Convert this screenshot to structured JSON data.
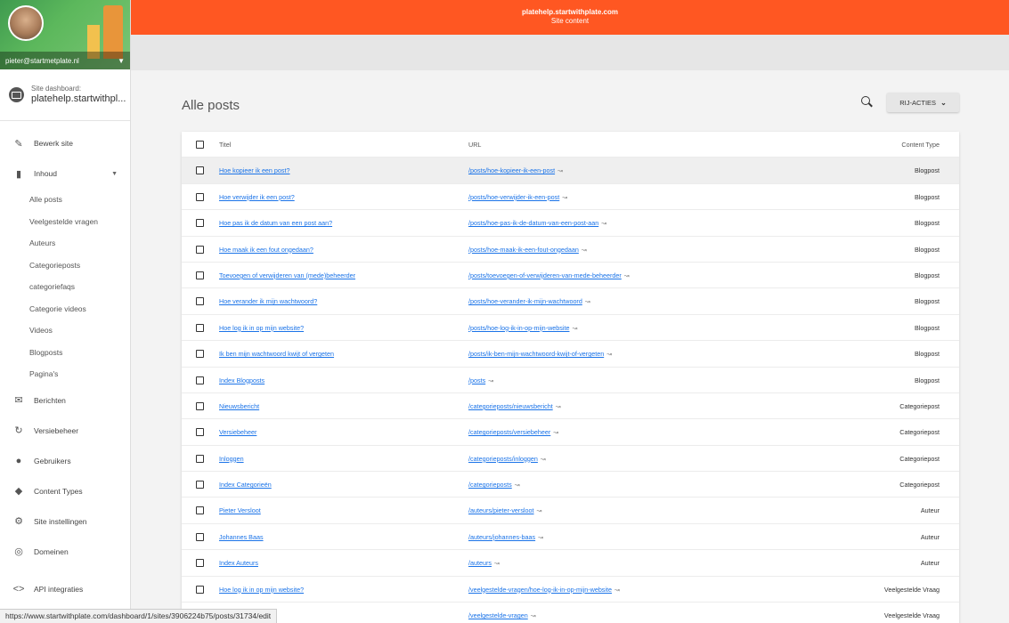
{
  "profile": {
    "email": "pieter@startmetplate.nl"
  },
  "site_dashboard": {
    "label": "Site dashboard:",
    "host": "platehelp.startwithpl..."
  },
  "topbar": {
    "host": "platehelp.startwithplate.com",
    "section": "Site content"
  },
  "nav": {
    "bewerk_site": "Bewerk site",
    "inhoud": "Inhoud",
    "sub_items": [
      "Alle posts",
      "Veelgestelde vragen",
      "Auteurs",
      "Categorieposts",
      "categoriefaqs",
      "Categorie videos",
      "Videos",
      "Blogposts",
      "Pagina's"
    ],
    "berichten": "Berichten",
    "versiebeheer": "Versiebeheer",
    "gebruikers": "Gebruikers",
    "content_types": "Content Types",
    "site_instellingen": "Site instellingen",
    "domeinen": "Domeinen",
    "api": "API integraties"
  },
  "page": {
    "title": "Alle posts",
    "rij_acties": "RIJ-ACTIES"
  },
  "table": {
    "headers": {
      "title": "Titel",
      "url": "URL",
      "content_type": "Content Type"
    },
    "rows": [
      {
        "title": "Hoe kopieer ik een post?",
        "url": "/posts/hoe-kopieer-ik-een-post",
        "type": "Blogpost"
      },
      {
        "title": "Hoe verwijder ik een post?",
        "url": "/posts/hoe-verwijder-ik-een-post",
        "type": "Blogpost"
      },
      {
        "title": "Hoe pas ik de datum van een post aan?",
        "url": "/posts/hoe-pas-ik-de-datum-van-een-post-aan",
        "type": "Blogpost"
      },
      {
        "title": "Hoe maak ik een fout ongedaan?",
        "url": "/posts/hoe-maak-ik-een-fout-ongedaan",
        "type": "Blogpost"
      },
      {
        "title": "Toevoegen of verwijderen van (mede)beheerder",
        "url": "/posts/toevoegen-of-verwijderen-van-mede-beheerder",
        "type": "Blogpost"
      },
      {
        "title": "Hoe verander ik mijn wachtwoord?",
        "url": "/posts/hoe-verander-ik-mijn-wachtwoord",
        "type": "Blogpost"
      },
      {
        "title": "Hoe log ik in op mijn website?",
        "url": "/posts/hoe-log-ik-in-op-mijn-website",
        "type": "Blogpost"
      },
      {
        "title": "Ik ben mijn wachtwoord kwijt of vergeten",
        "url": "/posts/ik-ben-mijn-wachtwoord-kwijt-of-vergeten",
        "type": "Blogpost"
      },
      {
        "title": "Index Blogposts",
        "url": "/posts",
        "type": "Blogpost"
      },
      {
        "title": "Nieuwsbericht",
        "url": "/categorieposts/nieuwsbericht",
        "type": "Categoriepost"
      },
      {
        "title": "Versiebeheer",
        "url": "/categorieposts/versiebeheer",
        "type": "Categoriepost"
      },
      {
        "title": "Inloggen",
        "url": "/categorieposts/inloggen",
        "type": "Categoriepost"
      },
      {
        "title": "Index Categorieën",
        "url": "/categorieposts",
        "type": "Categoriepost"
      },
      {
        "title": "Pieter Versloot",
        "url": "/auteurs/pieter-versloot",
        "type": "Auteur"
      },
      {
        "title": "Johannes Baas",
        "url": "/auteurs/johannes-baas",
        "type": "Auteur"
      },
      {
        "title": "Index Auteurs",
        "url": "/auteurs",
        "type": "Auteur"
      },
      {
        "title": "Hoe log ik in op mijn website?",
        "url": "/veelgestelde-vragen/hoe-log-ik-in-op-mijn-website",
        "type": "Veelgestelde Vraag"
      },
      {
        "title": "",
        "url": "/veelgestelde-vragen",
        "type": "Veelgestelde Vraag"
      }
    ]
  },
  "statusbar": {
    "url": "https://www.startwithplate.com/dashboard/1/sites/3906224b75/posts/31734/edit"
  },
  "colors": {
    "accent": "#ff5722",
    "link": "#1a73e8"
  }
}
